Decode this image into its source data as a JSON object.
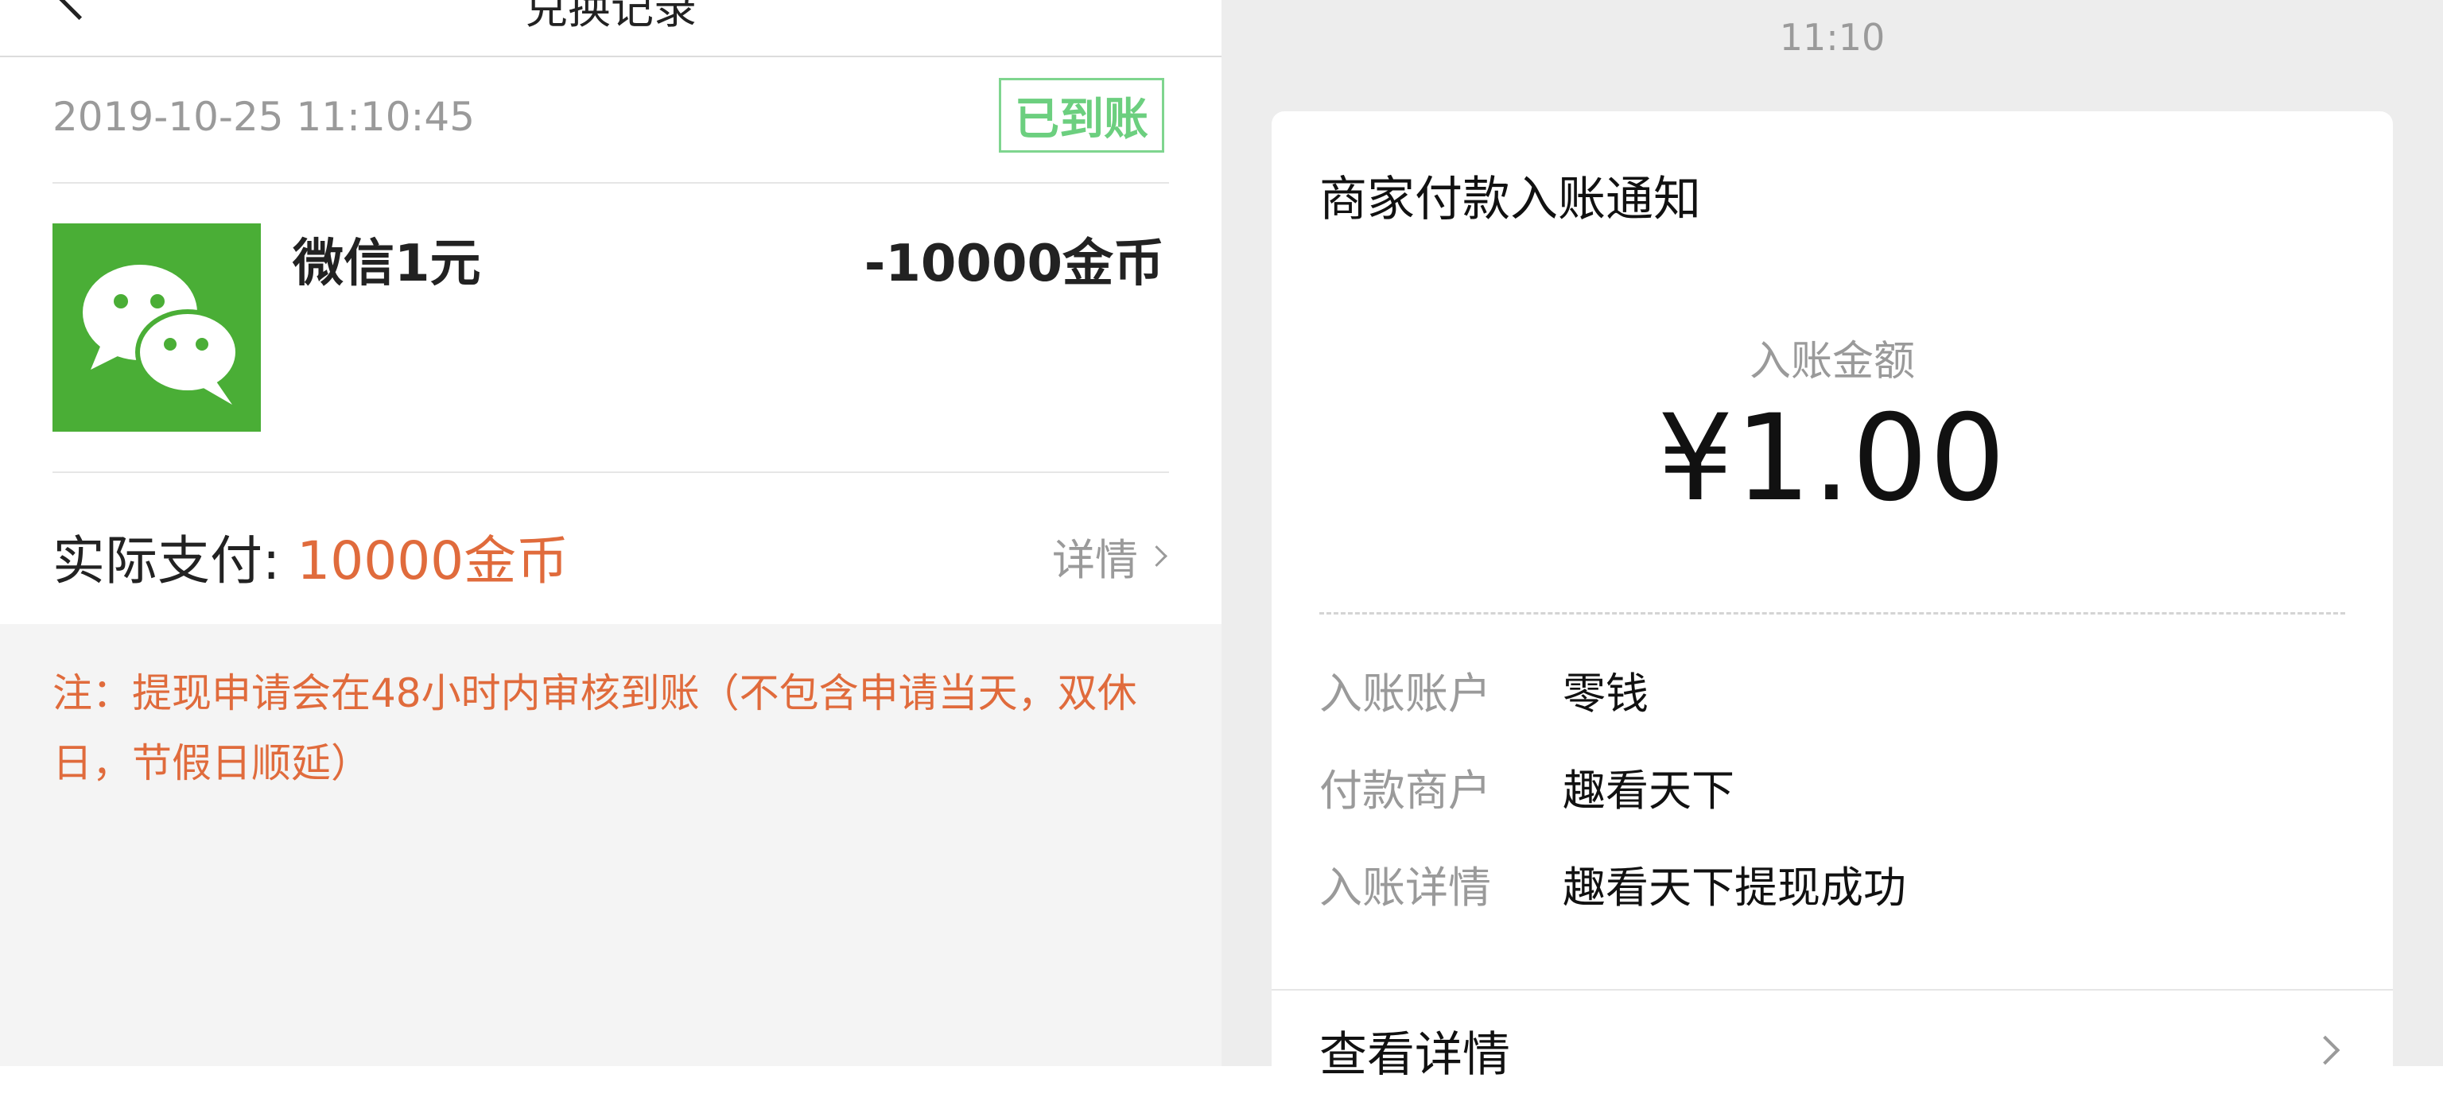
{
  "left_panel": {
    "nav": {
      "title": "兑换记录"
    },
    "record": {
      "datetime": "2019-10-25 11:10:45",
      "status": "已到账",
      "item_name": "微信1元",
      "item_cost": "-10000金币",
      "paid_label": "实际支付: ",
      "paid_value": "10000金币",
      "detail_label": "详情"
    },
    "note": "注：提现申请会在48小时内审核到账（不包含申请当天，双休日，节假日顺延）",
    "icon": "wechat-logo-icon",
    "colors": {
      "accent_orange": "#e06b3c",
      "status_green": "#6ccf7f",
      "wechat_green": "#4aae36"
    }
  },
  "right_panel": {
    "time": "11:10",
    "message": {
      "title": "商家付款入账通知",
      "amount_label": "入账金额",
      "amount_value": "¥1.00",
      "rows": [
        {
          "key": "入账账户",
          "value": "零钱"
        },
        {
          "key": "付款商户",
          "value": "趣看天下"
        },
        {
          "key": "入账详情",
          "value": "趣看天下提现成功"
        }
      ],
      "view_detail": "查看详情"
    }
  }
}
